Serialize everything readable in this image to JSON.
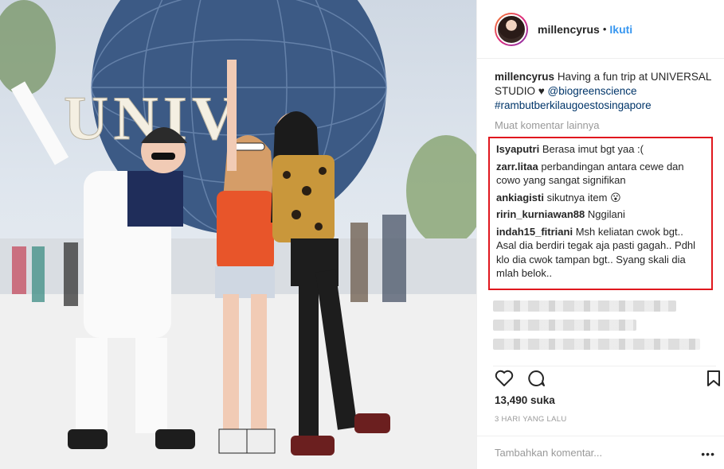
{
  "post": {
    "username": "millencyrus",
    "separator": "•",
    "follow_label": "Ikuti",
    "photo_sign_text": "UNIV",
    "caption": {
      "username": "millencyrus",
      "text": "Having a fun trip at UNIVERSAL STUDIO ♥",
      "mention": "@biogreenscience",
      "hashtag": "#rambutberkilaugoestosingapore"
    },
    "load_more_label": "Muat komentar lainnya",
    "comments": [
      {
        "user": "Isyaputri",
        "text": "Berasa imut bgt yaa :("
      },
      {
        "user": "zarr.litaa",
        "text": "perbandingan antara cewe dan cowo yang sangat signifikan"
      },
      {
        "user": "ankiagisti",
        "text": "sikutnya item 😮"
      },
      {
        "user": "ririn_kurniawan88",
        "text": "Nggilani"
      },
      {
        "user": "indah15_fitriani",
        "text": "Msh keliatan cwok bgt.. Asal dia berdiri tegak aja pasti gagah.. Pdhl klo dia cwok tampan bgt.. Syang skali dia mlah belok.."
      }
    ],
    "likes": "13,490 suka",
    "timestamp": "3 HARI YANG LALU",
    "comment_placeholder": "Tambahkan komentar...",
    "more_options": "•••"
  },
  "colors": {
    "highlight_border": "#e0171e",
    "link": "#003569",
    "follow": "#3897f0"
  },
  "icons": [
    "heart-icon",
    "comment-icon",
    "bookmark-icon"
  ]
}
